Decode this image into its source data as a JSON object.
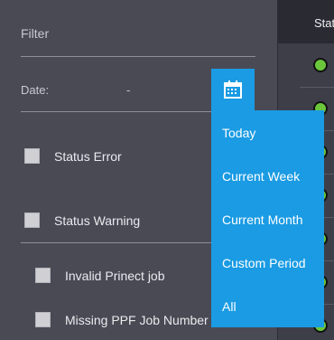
{
  "filter_panel": {
    "title": "Filter",
    "date_label": "Date:",
    "date_value": "-",
    "checkboxes": [
      {
        "label": "Status Error",
        "checked": false
      },
      {
        "label": "Status Warning",
        "checked": false
      },
      {
        "label": "Invalid Prinect job",
        "checked": false
      },
      {
        "label": "Missing PPF Job Number",
        "checked": false
      }
    ]
  },
  "date_dropdown": {
    "options": [
      "Today",
      "Current Week",
      "Current Month",
      "Custom Period",
      "All"
    ]
  },
  "table": {
    "header_partial": "Stat",
    "status_rows": [
      "ok",
      "ok",
      "ok",
      "ok",
      "ok",
      "ok",
      "ok"
    ]
  },
  "colors": {
    "accent": "#1a9be3",
    "panel_bg": "#4a4a55",
    "status_ok": "#6bc63b"
  },
  "icons": {
    "calendar": "calendar-icon"
  }
}
